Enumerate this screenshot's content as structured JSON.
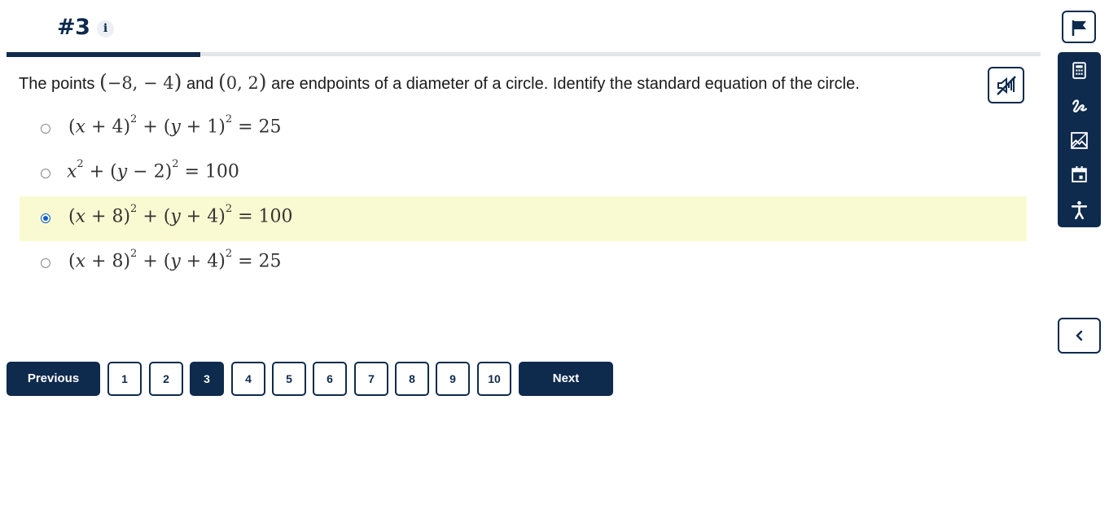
{
  "header": {
    "question_number": "#3",
    "info_label": "i"
  },
  "progress": {
    "fraction": 0.1875
  },
  "question": {
    "text_before": "The points",
    "point1": "−8,  − 4",
    "text_middle": "and",
    "point2": "0, 2",
    "text_after": "are endpoints of a diameter of a circle. Identify the standard equation of the circle."
  },
  "options": [
    {
      "h_sign": "+",
      "h": "4",
      "k_sign": "+",
      "k": "1",
      "r2": "25",
      "selected": false
    },
    {
      "text_x": "x",
      "k_sign": "−",
      "k": "2",
      "r2": "100",
      "selected": false
    },
    {
      "h_sign": "+",
      "h": "8",
      "k_sign": "+",
      "k": "4",
      "r2": "100",
      "selected": true
    },
    {
      "h_sign": "+",
      "h": "8",
      "k_sign": "+",
      "k": "4",
      "r2": "25",
      "selected": false
    }
  ],
  "pagination": {
    "previous_label": "Previous",
    "next_label": "Next",
    "pages": [
      "1",
      "2",
      "3",
      "4",
      "5",
      "6",
      "7",
      "8",
      "9",
      "10"
    ],
    "current_page": "3"
  },
  "icons": {
    "flag": "flag-icon",
    "audio": "audio-muted-icon",
    "calculator": "calculator-icon",
    "scribble": "scribble-icon",
    "image": "image-icon",
    "calendar": "calendar-icon",
    "accessibility": "accessibility-icon",
    "collapse": "chevron-left-icon"
  },
  "colors": {
    "primary": "#0e2a4d",
    "selected_row": "#fafad2",
    "radio_checked": "#0a5ec8"
  }
}
